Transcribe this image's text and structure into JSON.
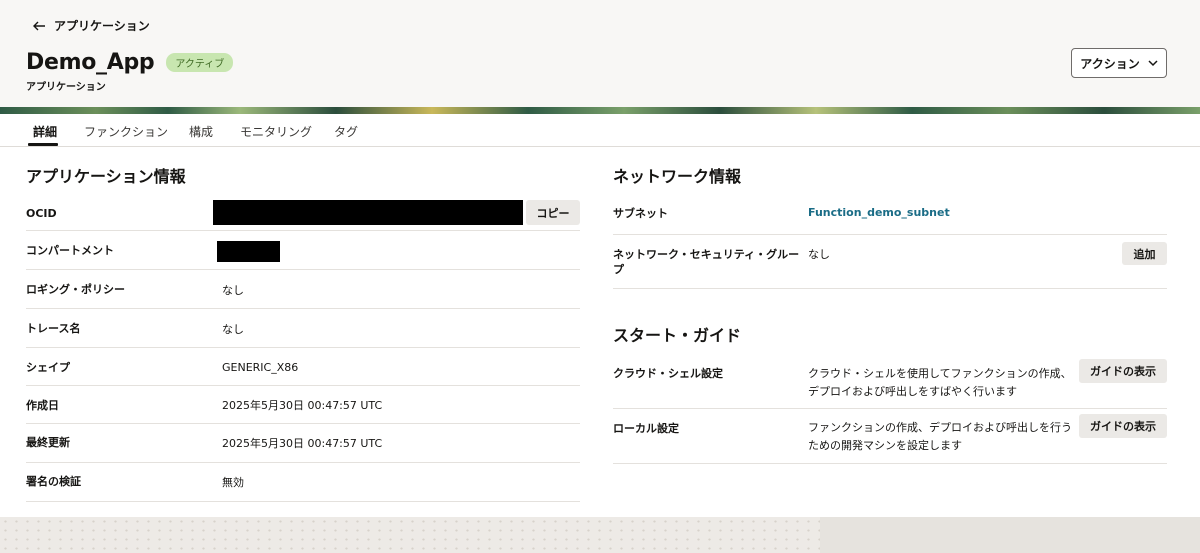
{
  "header": {
    "back_label": "アプリケーション",
    "title": "Demo_App",
    "status": "アクティブ",
    "subtitle": "アプリケーション",
    "actions_label": "アクション"
  },
  "tabs": [
    {
      "label": "詳細",
      "active": true
    },
    {
      "label": "ファンクション",
      "active": false
    },
    {
      "label": "構成",
      "active": false
    },
    {
      "label": "モニタリング",
      "active": false
    },
    {
      "label": "タグ",
      "active": false
    }
  ],
  "app_info": {
    "title": "アプリケーション情報",
    "copy_label": "コピー",
    "rows": [
      {
        "label": "OCID",
        "value": ""
      },
      {
        "label": "コンパートメント",
        "value": ""
      },
      {
        "label": "ロギング・ポリシー",
        "value": "なし"
      },
      {
        "label": "トレース名",
        "value": "なし"
      },
      {
        "label": "シェイプ",
        "value": "GENERIC_X86"
      },
      {
        "label": "作成日",
        "value": "2025年5月30日 00:47:57 UTC"
      },
      {
        "label": "最終更新",
        "value": "2025年5月30日 00:47:57 UTC"
      },
      {
        "label": "署名の検証",
        "value": "無効"
      }
    ]
  },
  "network": {
    "title": "ネットワーク情報",
    "subnet_label": "サブネット",
    "subnet_value": "Function_demo_subnet",
    "nsg_label": "ネットワーク・セキュリティ・グループ",
    "nsg_value": "なし",
    "add_label": "追加"
  },
  "start_guide": {
    "title": "スタート・ガイド",
    "items": [
      {
        "label": "クラウド・シェル設定",
        "description": "クラウド・シェルを使用してファンクションの作成、デプロイおよび呼出しをすばやく行います",
        "button": "ガイドの表示"
      },
      {
        "label": "ローカル設定",
        "description": "ファンクションの作成、デプロイおよび呼出しを行うための開発マシンを設定します",
        "button": "ガイドの表示"
      }
    ]
  },
  "colors": {
    "status_bg": "#c8e6b0",
    "link": "#1a6c86",
    "redaction": "#000000"
  }
}
